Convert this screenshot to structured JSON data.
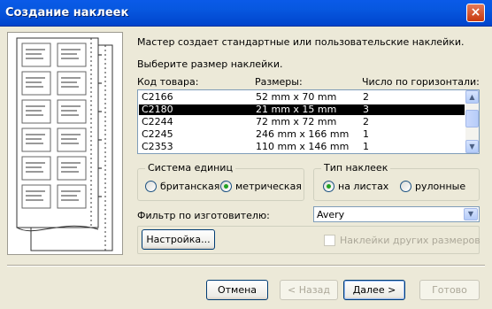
{
  "window": {
    "title": "Создание наклеек",
    "close_glyph": "×"
  },
  "intro": {
    "line1": "Мастер создает стандартные или пользовательские наклейки.",
    "line2": "Выберите размер наклейки."
  },
  "list": {
    "headers": [
      "Код товара:",
      "Размеры:",
      "Число по горизонтали:"
    ],
    "rows": [
      [
        "C2166",
        "52 mm x 70 mm",
        "2"
      ],
      [
        "C2180",
        "21 mm x 15 mm",
        "3"
      ],
      [
        "C2244",
        "72 mm x 72 mm",
        "2"
      ],
      [
        "C2245",
        "246 mm x 166 mm",
        "1"
      ],
      [
        "C2353",
        "110 mm x 146 mm",
        "1"
      ]
    ],
    "selected_index": 1
  },
  "units": {
    "title": "Система единиц",
    "options": [
      "британская",
      "метрическая"
    ],
    "selected": "метрическая"
  },
  "label_type": {
    "title": "Тип наклеек",
    "options": [
      "на листах",
      "рулонные"
    ],
    "selected": "на листах"
  },
  "filter": {
    "label": "Фильтр по изготовителю:",
    "value": "Avery"
  },
  "setup": {
    "button": "Настройка...",
    "checkbox_label": "Наклейки других размеров",
    "checked": false
  },
  "footer": {
    "cancel": "Отмена",
    "back": "< Назад",
    "next": "Далее >",
    "finish": "Готово"
  },
  "colors": {
    "title_blue": "#0054e3",
    "selection": "#000000",
    "dialog_bg": "#ece9d8"
  }
}
